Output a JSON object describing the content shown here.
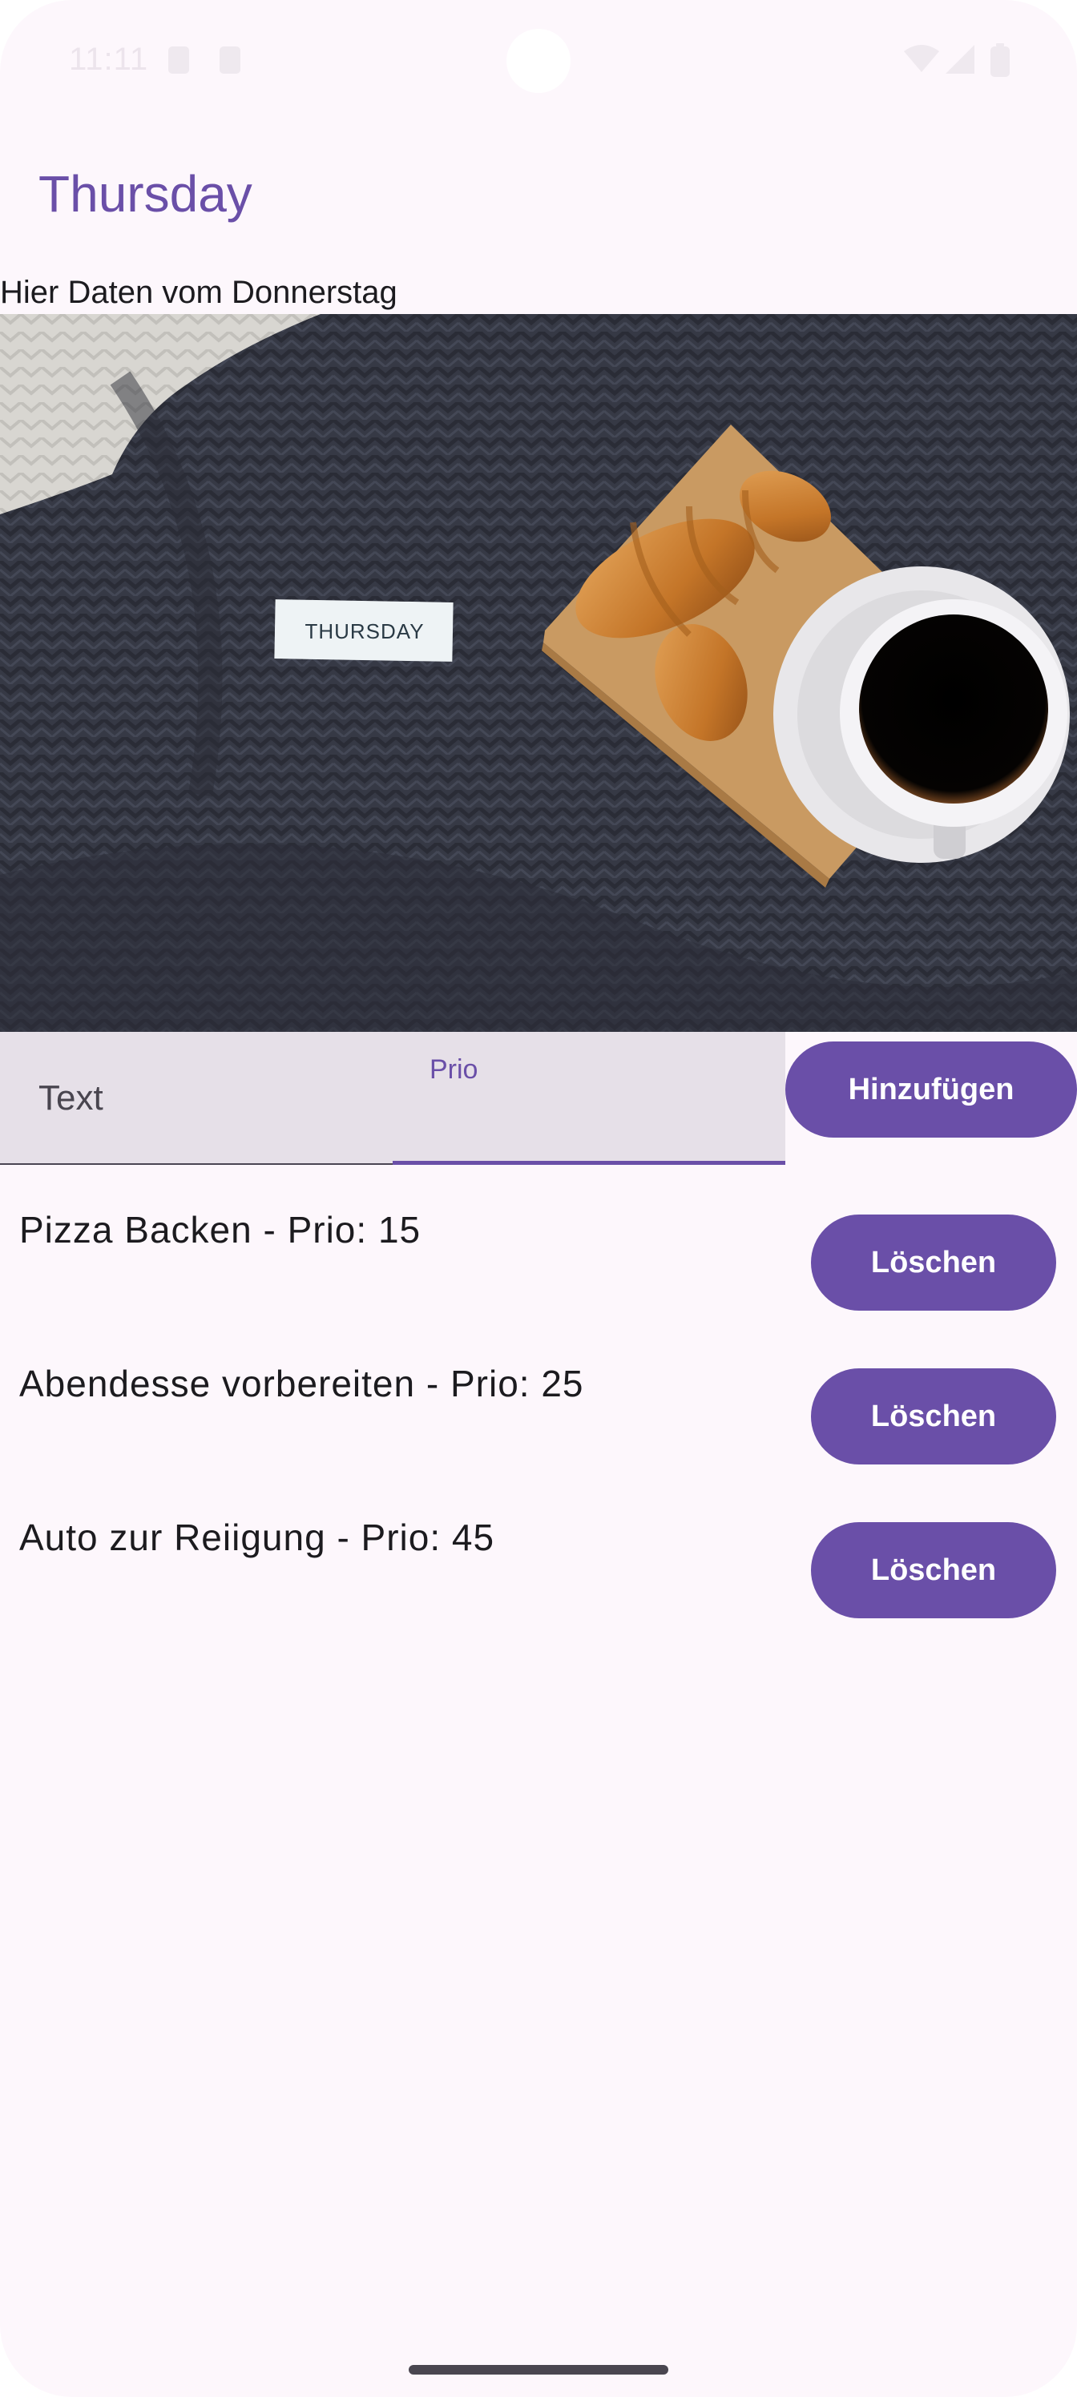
{
  "status_bar": {
    "time": "11:11"
  },
  "header": {
    "title": "Thursday"
  },
  "subtitle": "Hier Daten vom Donnerstag",
  "hero_image": {
    "card_label": "THURSDAY"
  },
  "form": {
    "text_placeholder": "Text",
    "prio_label": "Prio",
    "add_button_label": "Hinzufügen"
  },
  "tasks": [
    {
      "label": "Pizza Backen - Prio: 15",
      "delete_label": "Löschen"
    },
    {
      "label": "Abendesse vorbereiten - Prio: 25",
      "delete_label": "Löschen"
    },
    {
      "label": "Auto zur Reiigung - Prio: 45",
      "delete_label": "Löschen"
    }
  ],
  "colors": {
    "accent": "#6a4fa8",
    "background": "#fdf7fc",
    "field_fill": "#e6e0e8"
  }
}
